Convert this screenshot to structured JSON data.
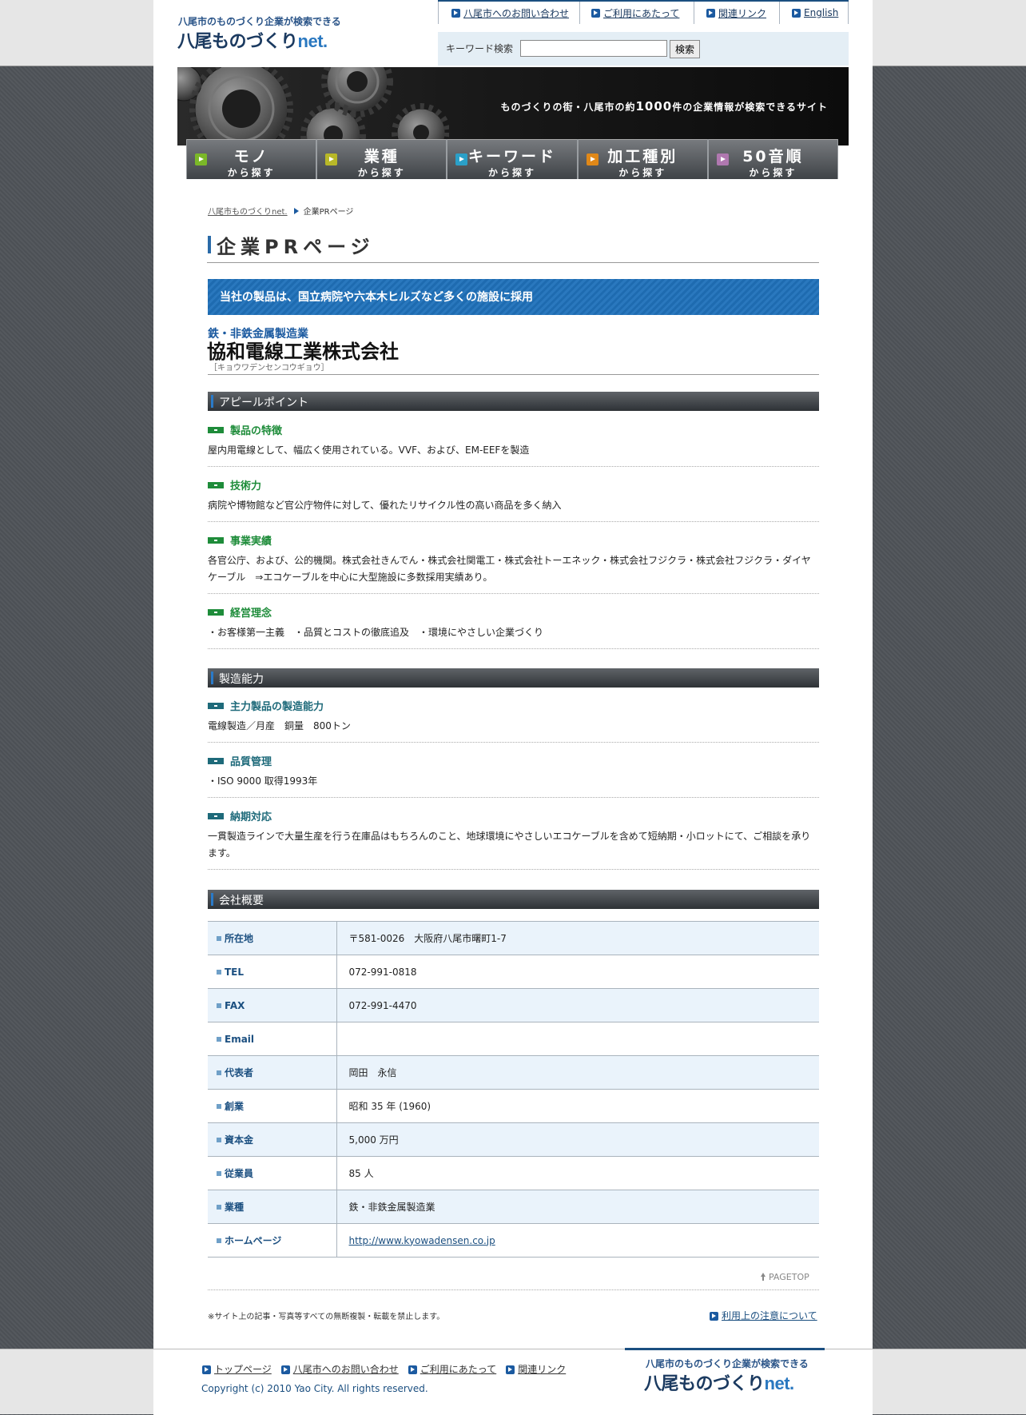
{
  "header": {
    "logo_tagline": "八尾市のものづくり企業が検索できる",
    "logo_name_main": "八尾ものづくり",
    "logo_name_suffix": "net.",
    "top_links": [
      "八尾市へのお問い合わせ",
      "ご利用にあたって",
      "関連リンク",
      "English"
    ],
    "search_label": "キーワード検索",
    "search_value": "",
    "search_button": "検索"
  },
  "hero": {
    "text_prefix": "ものづくりの街・八尾市の約",
    "text_number": "1000",
    "text_suffix": "件の企業情報が検索できるサイト"
  },
  "nav": [
    {
      "title": "モノ",
      "sub": "から探す",
      "color": "#7bb828"
    },
    {
      "title": "業種",
      "sub": "から探す",
      "color": "#b8b828"
    },
    {
      "title": "キーワード",
      "sub": "から探す",
      "color": "#2aa0c8"
    },
    {
      "title": "加工種別",
      "sub": "から探す",
      "color": "#e08818"
    },
    {
      "title": "50音順",
      "sub": "から探す",
      "color": "#b078b0"
    }
  ],
  "breadcrumb": {
    "home": "八尾市ものづくりnet.",
    "current": "企業PRページ"
  },
  "page_title": "企業PRページ",
  "banner": "当社の製品は、国立病院や六本木ヒルズなど多くの施設に採用",
  "company": {
    "industry": "鉄・非鉄金属製造業",
    "name": "協和電線工業株式会社",
    "kana": "［キョウワデンセンコウギョウ］"
  },
  "appeal": {
    "heading": "アピールポイント",
    "items": [
      {
        "title": "製品の特徴",
        "text": "屋内用電線として、幅広く使用されている。VVF、および、EM-EEFを製造"
      },
      {
        "title": "技術力",
        "text": "病院や博物館など官公庁物件に対して、優れたリサイクル性の高い商品を多く納入"
      },
      {
        "title": "事業実績",
        "text": "各官公庁、および、公的機関。株式会社きんでん・株式会社関電工・株式会社トーエネック・株式会社フジクラ・株式会社フジクラ・ダイヤケーブル　⇒エコケーブルを中心に大型施設に多数採用実績あり。"
      },
      {
        "title": "経営理念",
        "text": "・お客様第一主義　・品質とコストの徹底追及　・環境にやさしい企業づくり"
      }
    ]
  },
  "capability": {
    "heading": "製造能力",
    "items": [
      {
        "title": "主力製品の製造能力",
        "text": "電線製造／月産　銅量　800トン"
      },
      {
        "title": "品質管理",
        "text": "・ISO 9000  取得1993年"
      },
      {
        "title": "納期対応",
        "text": "一貫製造ラインで大量生産を行う在庫品はもちろんのこと、地球環境にやさしいエコケーブルを含めて短納期・小ロットにて、ご相談を承ります。"
      }
    ]
  },
  "profile": {
    "heading": "会社概要",
    "rows": [
      {
        "key": "所在地",
        "value": "〒581-0026　大阪府八尾市曙町1-7"
      },
      {
        "key": "TEL",
        "value": "072-991-0818"
      },
      {
        "key": "FAX",
        "value": "072-991-4470"
      },
      {
        "key": "Email",
        "value": ""
      },
      {
        "key": "代表者",
        "value": "岡田　永信"
      },
      {
        "key": "創業",
        "value": "昭和 35 年 (1960)"
      },
      {
        "key": "資本金",
        "value": "5,000 万円"
      },
      {
        "key": "従業員",
        "value": "85 人"
      },
      {
        "key": "業種",
        "value": "鉄・非鉄金属製造業"
      },
      {
        "key": "ホームページ",
        "value": "http://www.kyowadensen.co.jp"
      }
    ]
  },
  "pagetop": "PAGETOP",
  "copy_note": "※サイト上の記事・写真等すべての無断複製・転載を禁止します。",
  "terms_link": "利用上の注意について",
  "footer": {
    "links": [
      "トップページ",
      "八尾市へのお問い合わせ",
      "ご利用にあたって",
      "関連リンク"
    ],
    "copyright": "Copyright (c) 2010 Yao City. All rights reserved.",
    "logo_tagline": "八尾市のものづくり企業が検索できる",
    "logo_name_main": "八尾ものづくり",
    "logo_name_suffix": "net."
  }
}
